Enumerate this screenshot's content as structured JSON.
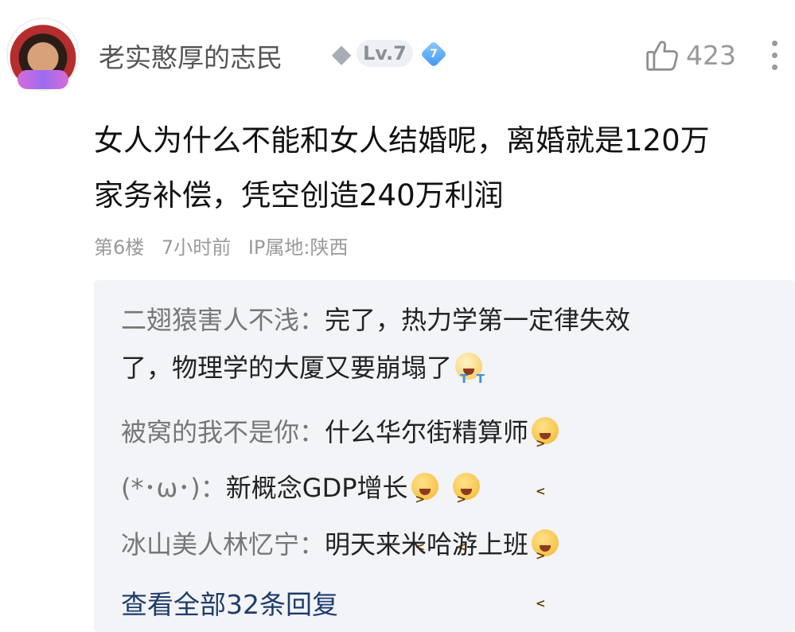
{
  "user": {
    "name": "老实憨厚的志民",
    "level": "Lv.7",
    "badge_number": "7"
  },
  "likes": "423",
  "post": {
    "lines": [
      "女人为什么不能和女人结婚呢，离婚就是120万",
      "家务补偿，凭空创造240万利润"
    ],
    "floor": "第6楼",
    "time": "7小时前",
    "ip": "IP属地:陕西"
  },
  "replies": [
    {
      "name": "二翅猿害人不浅",
      "sep": "：",
      "text1": "完了，热力学第一定律失效",
      "text2": "了，物理学的大厦又要崩塌了",
      "emojis": [
        "crying-laugh"
      ]
    },
    {
      "name": "被窝的我不是你",
      "sep": "：",
      "text": "什么华尔街精算师",
      "emojis": [
        "laugh"
      ]
    },
    {
      "name": "(*･ω･)",
      "sep": "：",
      "text": "新概念GDP增长",
      "emojis": [
        "laugh",
        "laugh"
      ]
    },
    {
      "name": "冰山美人林忆宁",
      "sep": "：",
      "text": "明天来米哈游上班",
      "emojis": [
        "laugh"
      ]
    }
  ],
  "view_all": "查看全部32条回复",
  "icons": {
    "avatar": "user-avatar",
    "level": "diamond-level-icon",
    "badge": "blue-gem-badge-icon",
    "like": "thumbs-up-icon",
    "more": "more-vertical-icon"
  },
  "colors": {
    "view_all": "#1f3c6b",
    "reply_bg": "#f3f4f7",
    "meta": "#9a9a9a"
  }
}
